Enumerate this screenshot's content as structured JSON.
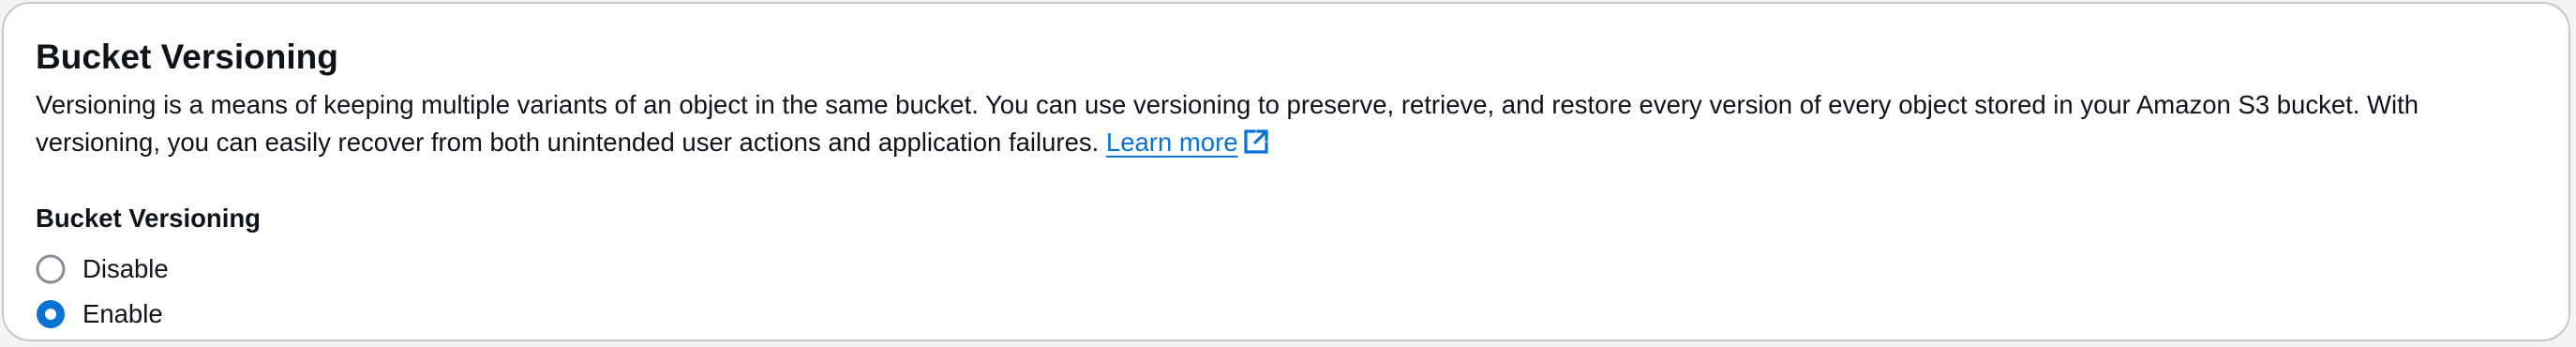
{
  "section": {
    "title": "Bucket Versioning",
    "description": "Versioning is a means of keeping multiple variants of an object in the same bucket. You can use versioning to preserve, retrieve, and restore every version of every object stored in your Amazon S3 bucket. With versioning, you can easily recover from both unintended user actions and application failures.",
    "learn_more_label": "Learn more",
    "learn_more_icon": "external-link-icon"
  },
  "versioning_field": {
    "label": "Bucket Versioning",
    "selected": "Enable",
    "options": [
      {
        "label": "Disable",
        "checked": false
      },
      {
        "label": "Enable",
        "checked": true
      }
    ]
  },
  "colors": {
    "accent": "#0972d3",
    "text": "#0f141a",
    "border": "#c6c6cd",
    "radio_unchecked_border": "#8c8c94"
  }
}
